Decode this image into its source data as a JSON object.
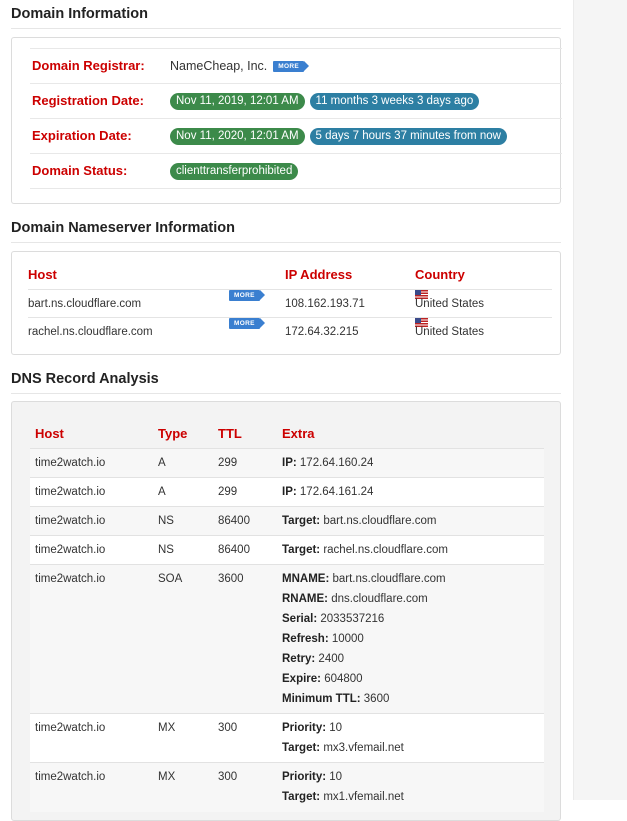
{
  "domain_info": {
    "title": "Domain Information",
    "registrar_label": "Domain Registrar:",
    "registrar_value": "NameCheap, Inc.",
    "more_label": "MORE",
    "registration_label": "Registration Date:",
    "registration_date": "Nov 11, 2019, 12:01 AM",
    "registration_ago": "11 months 3 weeks 3 days ago",
    "expiration_label": "Expiration Date:",
    "expiration_date": "Nov 11, 2020, 12:01 AM",
    "expiration_from_now": "5 days 7 hours 37 minutes from now",
    "status_label": "Domain Status:",
    "status_value": "clienttransferprohibited"
  },
  "nameservers": {
    "title": "Domain Nameserver Information",
    "headers": {
      "host": "Host",
      "ip": "IP Address",
      "country": "Country"
    },
    "rows": [
      {
        "host": "bart.ns.cloudflare.com",
        "more": "MORE",
        "ip": "108.162.193.71",
        "country": "United States"
      },
      {
        "host": "rachel.ns.cloudflare.com",
        "more": "MORE",
        "ip": "172.64.32.215",
        "country": "United States"
      }
    ]
  },
  "dns": {
    "title": "DNS Record Analysis",
    "headers": {
      "host": "Host",
      "type": "Type",
      "ttl": "TTL",
      "extra": "Extra"
    },
    "rows": [
      {
        "host": "time2watch.io",
        "type": "A",
        "ttl": "299",
        "extra": [
          {
            "k": "IP:",
            "v": " 172.64.160.24"
          }
        ]
      },
      {
        "host": "time2watch.io",
        "type": "A",
        "ttl": "299",
        "extra": [
          {
            "k": "IP:",
            "v": " 172.64.161.24"
          }
        ]
      },
      {
        "host": "time2watch.io",
        "type": "NS",
        "ttl": "86400",
        "extra": [
          {
            "k": "Target:",
            "v": " bart.ns.cloudflare.com"
          }
        ]
      },
      {
        "host": "time2watch.io",
        "type": "NS",
        "ttl": "86400",
        "extra": [
          {
            "k": "Target:",
            "v": " rachel.ns.cloudflare.com"
          }
        ]
      },
      {
        "host": "time2watch.io",
        "type": "SOA",
        "ttl": "3600",
        "extra": [
          {
            "k": "MNAME:",
            "v": " bart.ns.cloudflare.com"
          },
          {
            "k": "RNAME:",
            "v": " dns.cloudflare.com"
          },
          {
            "k": "Serial:",
            "v": " 2033537216"
          },
          {
            "k": "Refresh:",
            "v": " 10000"
          },
          {
            "k": "Retry:",
            "v": " 2400"
          },
          {
            "k": "Expire:",
            "v": " 604800"
          },
          {
            "k": "Minimum TTL:",
            "v": " 3600"
          }
        ]
      },
      {
        "host": "time2watch.io",
        "type": "MX",
        "ttl": "300",
        "extra": [
          {
            "k": "Priority:",
            "v": " 10"
          },
          {
            "k": "Target:",
            "v": " mx3.vfemail.net"
          }
        ]
      },
      {
        "host": "time2watch.io",
        "type": "MX",
        "ttl": "300",
        "extra": [
          {
            "k": "Priority:",
            "v": " 10"
          },
          {
            "k": "Target:",
            "v": " mx1.vfemail.net"
          }
        ]
      }
    ]
  },
  "colors": {
    "label_red": "#cc0000",
    "badge_green": "#3c8a4a",
    "badge_blue": "#2d7fa3",
    "more_blue": "#3a7fd0"
  },
  "icons": {
    "flag": "us-flag-icon",
    "more": "more-arrow-tag"
  }
}
